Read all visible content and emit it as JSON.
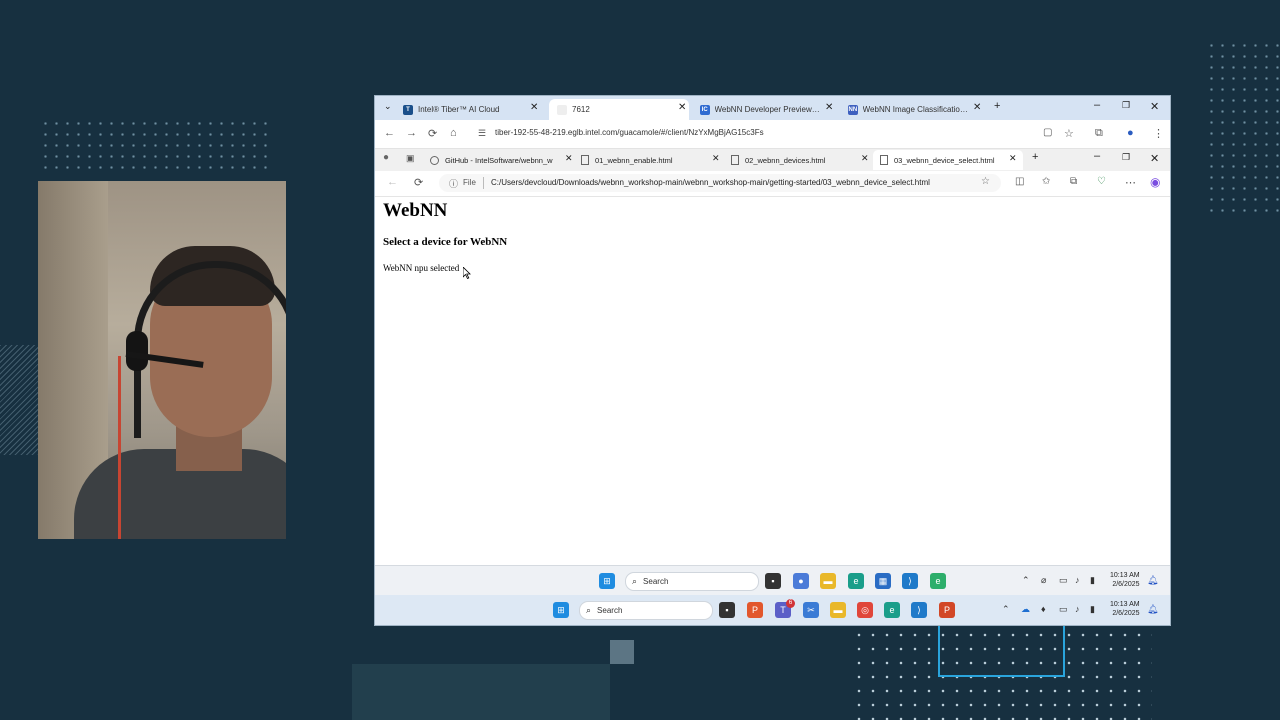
{
  "outer_browser": {
    "tabs": [
      {
        "label": "Intel® Tiber™ AI Cloud",
        "icon": "T",
        "color": "#1a73c8"
      },
      {
        "label": "7612",
        "icon": "",
        "color": "#ffffff"
      },
      {
        "label": "WebNN Developer Preview - In",
        "icon": "IC",
        "color": "#2f6bd1"
      },
      {
        "label": "WebNN Image Classification E",
        "icon": "NN",
        "color": "#3d5fbf"
      }
    ],
    "new_tab": "+",
    "url": "tiber-192-55-48-219.eglb.intel.com/guacamole/#/client/NzYxMgBjAG15c3Fs"
  },
  "inner_browser": {
    "tabs": [
      {
        "label": "GitHub - IntelSoftware/webnn_w"
      },
      {
        "label": "01_webnn_enable.html"
      },
      {
        "label": "02_webnn_devices.html"
      },
      {
        "label": "03_webnn_device_select.html"
      }
    ],
    "new_tab": "+",
    "file_label": "File",
    "url": "C:/Users/devcloud/Downloads/webnn_workshop-main/webnn_workshop-main/getting-started/03_webnn_device_select.html"
  },
  "page": {
    "title": "WebNN",
    "subtitle": "Select a device for WebNN",
    "status": "WebNN npu selected"
  },
  "taskbar_inner": {
    "search_label": "Search",
    "time": "10:13 AM",
    "date": "2/6/2025"
  },
  "taskbar_outer": {
    "search_label": "Search",
    "badge": "6",
    "time": "10:13 AM",
    "date": "2/6/2025"
  }
}
